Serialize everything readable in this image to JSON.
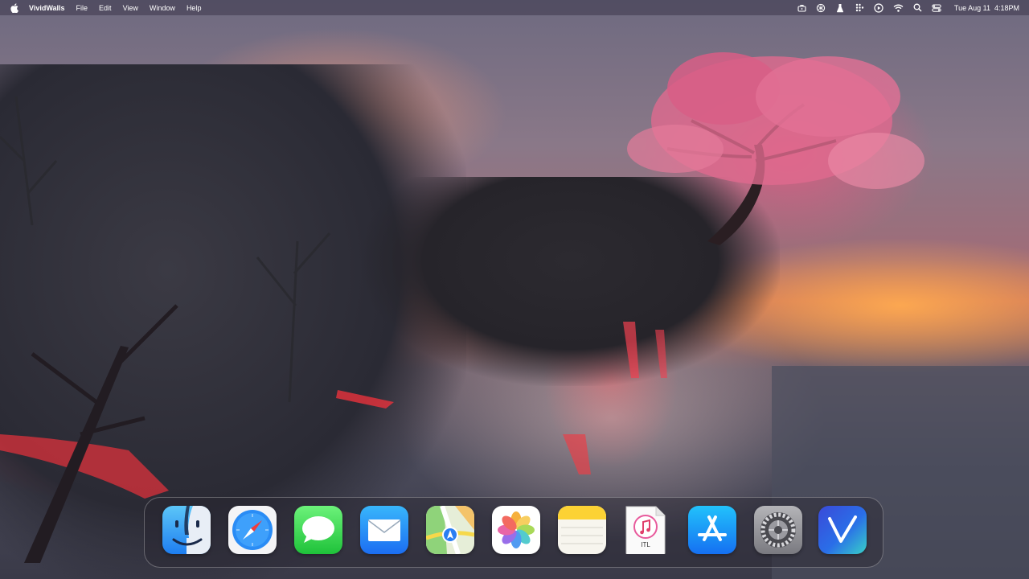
{
  "menubar": {
    "app_name": "VividWalls",
    "menus": [
      "File",
      "Edit",
      "View",
      "Window",
      "Help"
    ],
    "status_icons": [
      "briefcase-icon",
      "chatgpt-icon",
      "flask-icon",
      "grid-dots-icon",
      "play-circle-icon",
      "wifi-icon",
      "search-icon",
      "control-center-icon"
    ],
    "clock": {
      "date": "Tue Aug 11",
      "time": "4:18PM"
    }
  },
  "dock": {
    "apps": [
      {
        "name": "Finder",
        "icon": "finder-icon"
      },
      {
        "name": "Safari",
        "icon": "safari-icon"
      },
      {
        "name": "Messages",
        "icon": "messages-icon"
      },
      {
        "name": "Mail",
        "icon": "mail-icon"
      },
      {
        "name": "Maps",
        "icon": "maps-icon"
      },
      {
        "name": "Photos",
        "icon": "photos-icon"
      },
      {
        "name": "Notes",
        "icon": "notes-icon"
      },
      {
        "name": "iTunes Library",
        "icon": "itl-file-icon",
        "label": "ITL"
      },
      {
        "name": "App Store",
        "icon": "app-store-icon"
      },
      {
        "name": "System Settings",
        "icon": "settings-icon"
      },
      {
        "name": "VividWalls",
        "icon": "vividwalls-icon"
      }
    ]
  }
}
